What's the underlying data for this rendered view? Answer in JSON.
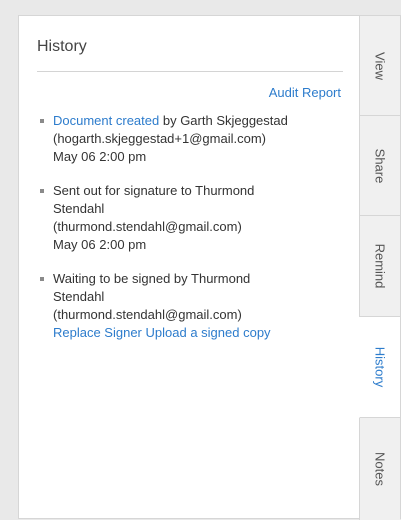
{
  "history": {
    "title": "History",
    "audit_report": "Audit Report",
    "events": [
      {
        "action": "Document created",
        "action_is_link": true,
        "by": " by Garth Skjeggestad",
        "email": "(hogarth.skjeggestad+1@gmail.com)",
        "date": "May 06 2:00 pm"
      },
      {
        "action": "Sent out for signature",
        "by_line1": " to Thurmond",
        "by_line2": "Stendahl",
        "email": "(thurmond.stendahl@gmail.com)",
        "date": "May 06 2:00 pm"
      },
      {
        "action": "Waiting to be signed",
        "by_line1": " by Thurmond",
        "by_line2": "Stendahl",
        "email": "(thurmond.stendahl@gmail.com)",
        "link_replace": "Replace Signer",
        "link_upload": "Upload a signed copy"
      }
    ]
  },
  "tabs": [
    {
      "label": "View",
      "active": false
    },
    {
      "label": "Share",
      "active": false
    },
    {
      "label": "Remind",
      "active": false
    },
    {
      "label": "History",
      "active": true
    },
    {
      "label": "Notes",
      "active": false
    }
  ],
  "colors": {
    "link": "#2d7ccc",
    "background": "#e9e9e9",
    "panel": "#ffffff",
    "tab_inactive": "#f0f0f0"
  }
}
